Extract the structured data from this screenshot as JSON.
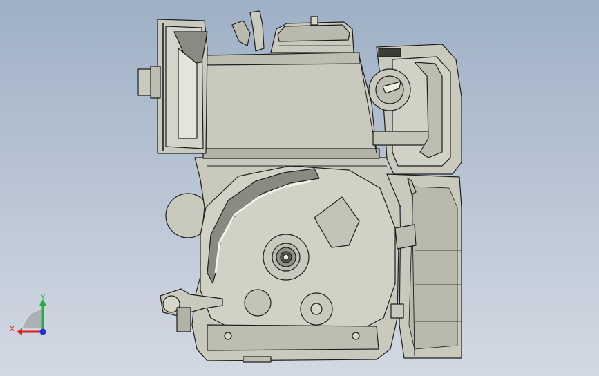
{
  "viewport": {
    "background_top": "#9fb0c5",
    "background_bottom": "#d3d9e3"
  },
  "model": {
    "fill_color": "#c9c9bd",
    "shade_color": "#9d9d91",
    "edge_color": "#1e1e1e",
    "highlight_color": "#ecece6"
  },
  "triad": {
    "x_label": "X",
    "y_label": "Y",
    "x_color": "#e0201b",
    "y_color": "#1fb33a",
    "z_color": "#1f2fd6"
  }
}
